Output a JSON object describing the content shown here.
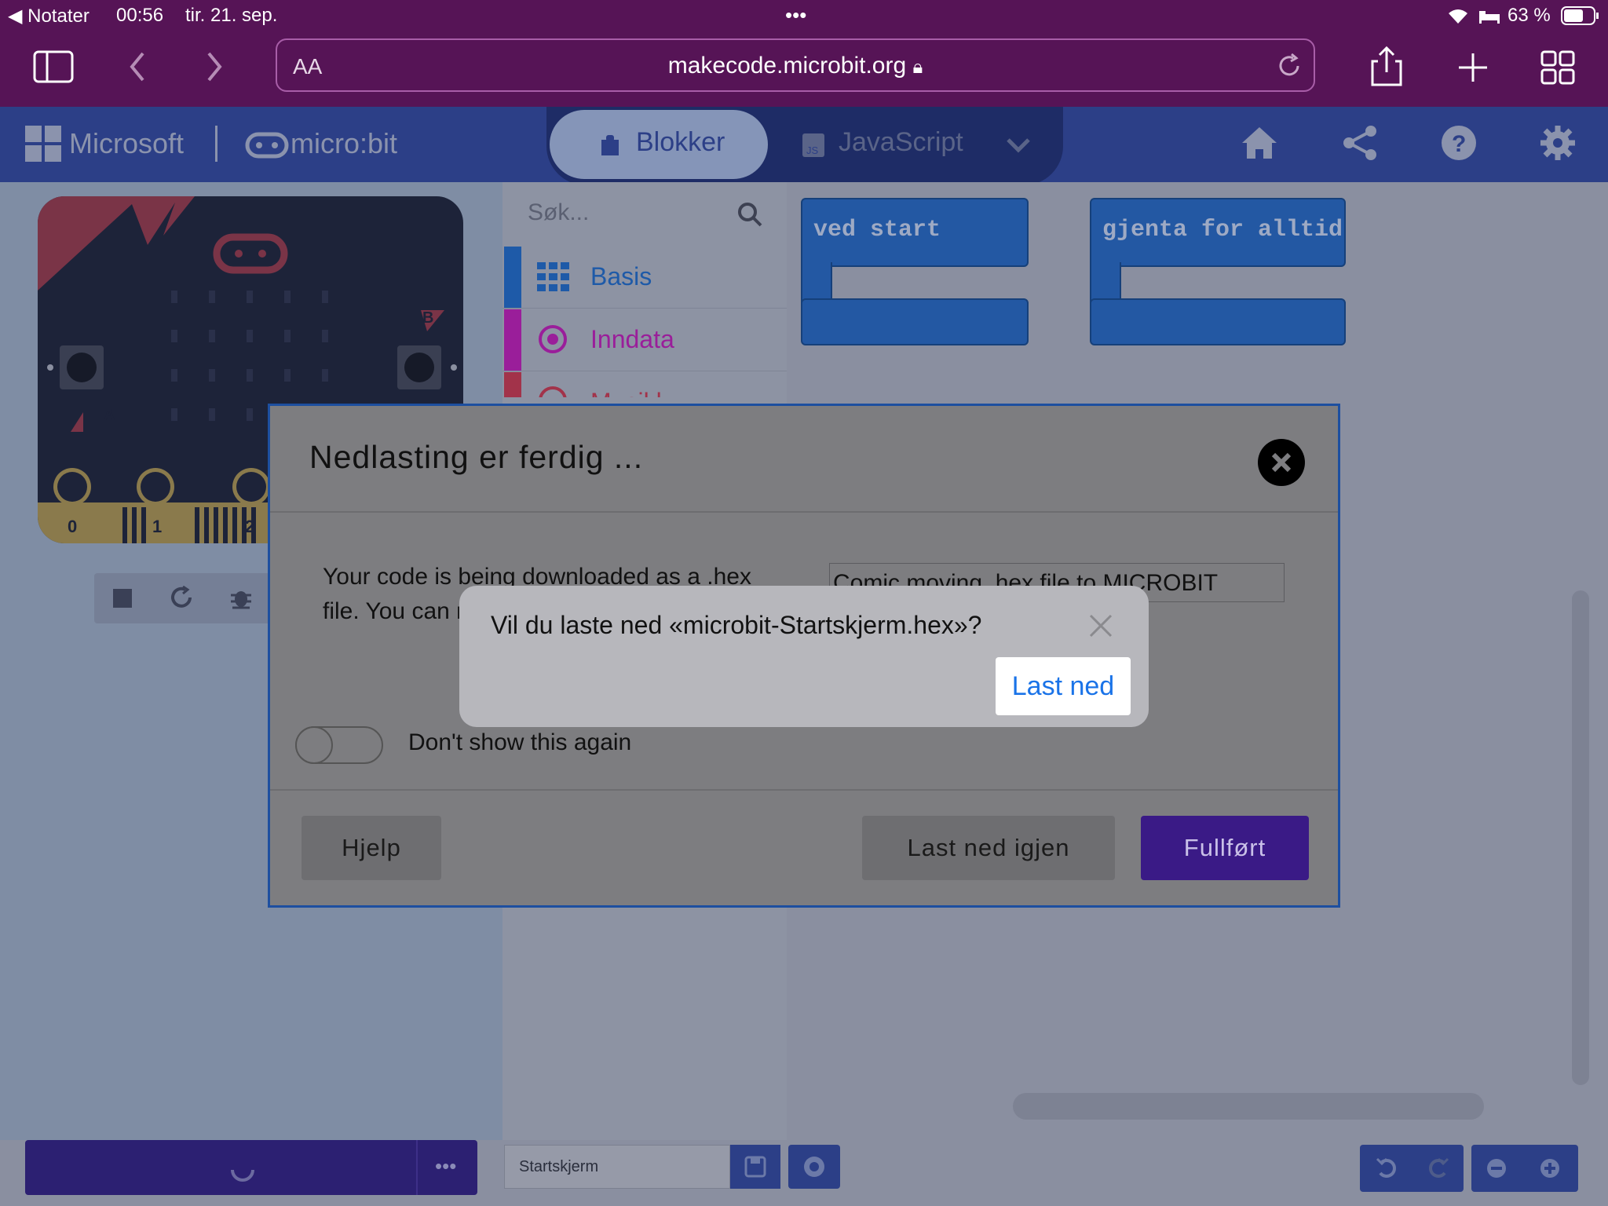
{
  "status_bar": {
    "back_app": "◀ Notater",
    "time": "00:56",
    "date": "tir. 21. sep.",
    "dots": "•••",
    "battery": "63 %"
  },
  "safari": {
    "text_size_label": "AA",
    "url": "makecode.microbit.org"
  },
  "header": {
    "microsoft_label": "Microsoft",
    "microbit_label": "micro:bit",
    "tabs": [
      {
        "label": "Blokker"
      },
      {
        "label": "JavaScript"
      }
    ]
  },
  "toolbox": {
    "search_placeholder": "Søk...",
    "items": [
      {
        "label": "Basis",
        "color": "#1e5aa8"
      },
      {
        "label": "Inndata",
        "color": "#9a1e9a"
      },
      {
        "label": "Musikk",
        "color": "#a2334a"
      }
    ]
  },
  "workspace": {
    "blocks": [
      {
        "label": "ved start"
      },
      {
        "label": "gjenta for alltid"
      }
    ]
  },
  "simulator": {
    "pins": [
      "0",
      "1",
      "2"
    ],
    "button_a": "A",
    "button_b": "B"
  },
  "dialog": {
    "title": "Nedlasting er ferdig ...",
    "body": "Your code is being downloaded as a .hex file. You can micro:bit usi explorer.",
    "side_text": "Comic moving .hex file to MICROBIT",
    "toggle_label": "Don't show this again",
    "help_label": "Hjelp",
    "download_again_label": "Last ned igjen",
    "done_label": "Fullført"
  },
  "alert": {
    "question": "Vil du laste ned «microbit-Startskjerm.hex»?",
    "action_label": "Last ned"
  },
  "footer": {
    "project_name": "Startskjerm",
    "more_label": "•••"
  },
  "colors": {
    "safari_bar": "#561456",
    "app_header": "#2c3f87",
    "primary_button": "#3a1a86",
    "link_blue": "#1a73e8"
  }
}
